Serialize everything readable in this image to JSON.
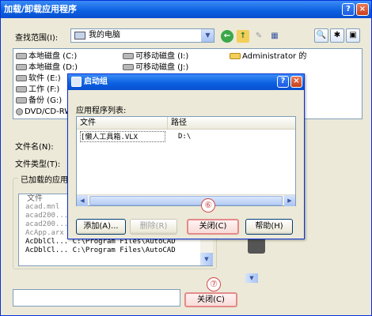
{
  "main_window": {
    "title": "加载/卸载应用程序",
    "help_button": "?",
    "close_button": "×",
    "look_in_label": "查找范围(I):",
    "look_in_value": "我的电脑",
    "drives": [
      "本地磁盘 (C:)",
      "本地磁盘 (D:)",
      "软件 (E:)",
      "工作 (F:)",
      "备份 (G:)",
      "DVD/CD-RW"
    ],
    "removable": [
      "可移动磁盘 (I:)",
      "可移动磁盘 (J:)"
    ],
    "folder_item": "Administrator 的",
    "filename_label": "文件名(N):",
    "filetype_label": "文件类型(T):",
    "loaded_group_title": "已加载的应用",
    "loaded_col_header": "文件",
    "loaded_rows": [
      "acad.mnl",
      "acad200...",
      "acad200...",
      "AcApp.arx",
      "AcDblCl...      C:\\Program Files\\AutoCAD",
      "AcDblCl...      C:\\Program Files\\AutoCAD"
    ],
    "close_button_label": "关闭(C)",
    "step7_badge": "⑦"
  },
  "dialog": {
    "title": "启动组",
    "help_button": "?",
    "close_button": "×",
    "list_label": "应用程序列表:",
    "columns": [
      "文件",
      "路径"
    ],
    "rows": [
      {
        "file": "[懒人工具箱.VLX",
        "path": "D:\\"
      }
    ],
    "add_button": "添加(A)...",
    "remove_button": "删除(R)",
    "close_button_label": "关闭(C)",
    "help_button_label": "帮助(H)",
    "step6_badge": "⑥"
  },
  "colors": {
    "titlebar": "#0a5fe0",
    "window_bg": "#ece9d8",
    "highlight_border": "#e48a8a",
    "badge": "#d24a4a"
  }
}
